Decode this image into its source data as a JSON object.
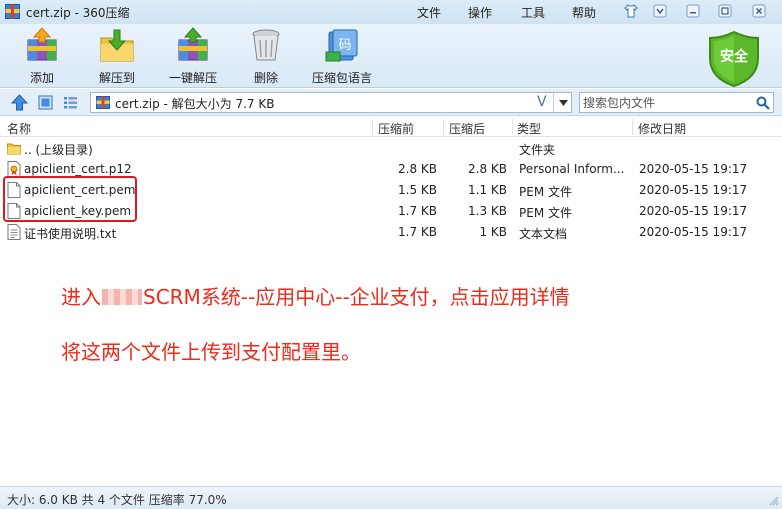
{
  "window": {
    "title": "cert.zip - 360压缩"
  },
  "menu": [
    "文件",
    "操作",
    "工具",
    "帮助"
  ],
  "toolbar": {
    "items": [
      {
        "label": "添加",
        "icon": "add-archive-icon"
      },
      {
        "label": "解压到",
        "icon": "extract-to-icon"
      },
      {
        "label": "一键解压",
        "icon": "one-click-extract-icon"
      },
      {
        "label": "删除",
        "icon": "delete-trash-icon"
      },
      {
        "label": "压缩包语言",
        "icon": "archive-language-icon"
      }
    ],
    "language_icon_text": "码",
    "security_badge": "安全"
  },
  "address": {
    "path": "cert.zip - 解包大小为 7.7 KB",
    "search_placeholder": "搜索包内文件"
  },
  "columns": [
    "名称",
    "压缩前",
    "压缩后",
    "类型",
    "修改日期"
  ],
  "files": [
    {
      "name": ".. (上级目录)",
      "original": "",
      "compressed": "",
      "type": "文件夹",
      "modified": "",
      "icon": "folder-up-icon"
    },
    {
      "name": "apiclient_cert.p12",
      "original": "2.8 KB",
      "compressed": "2.8 KB",
      "type": "Personal Inform...",
      "modified": "2020-05-15 19:17",
      "icon": "certificate-file-icon"
    },
    {
      "name": "apiclient_cert.pem",
      "original": "1.5 KB",
      "compressed": "1.1 KB",
      "type": "PEM 文件",
      "modified": "2020-05-15 19:17",
      "icon": "file-icon"
    },
    {
      "name": "apiclient_key.pem",
      "original": "1.7 KB",
      "compressed": "1.3 KB",
      "type": "PEM 文件",
      "modified": "2020-05-15 19:17",
      "icon": "file-icon"
    },
    {
      "name": "证书使用说明.txt",
      "original": "1.7 KB",
      "compressed": "1 KB",
      "type": "文本文档",
      "modified": "2020-05-15 19:17",
      "icon": "text-file-icon"
    }
  ],
  "annotations": {
    "line1_prefix": "进入",
    "line1_suffix": "SCRM系统--应用中心--企业支付，点击应用详情",
    "line2": "将这两个文件上传到支付配置里。"
  },
  "status": "大小: 6.0 KB 共 4 个文件 压缩率 77.0%",
  "colors": {
    "annotation_red": "#ee2a1a",
    "highlight_border": "#e0191d",
    "shield_green": "#5cb82a"
  }
}
